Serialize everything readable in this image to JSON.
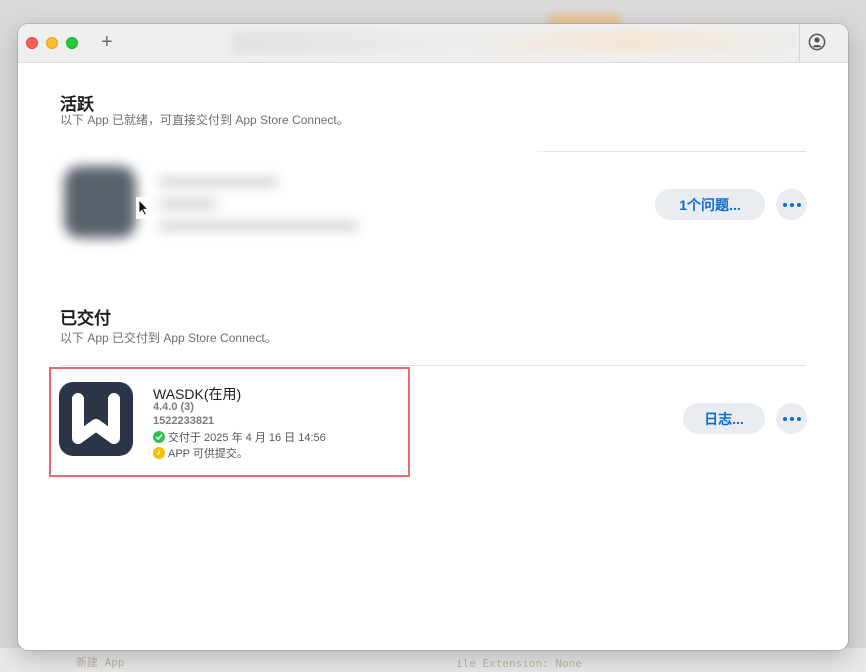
{
  "window": {
    "new_tab_symbol": "+",
    "controls": {
      "close_icon": "close-icon",
      "minimize_icon": "minimize-icon",
      "zoom_icon": "zoom-icon",
      "account_icon": "person-circle-icon"
    }
  },
  "background_code": {
    "left": "新建 App",
    "right": "ile Extension: None"
  },
  "sections": {
    "active": {
      "title": "活跃",
      "subtitle": "以下 App 已就绪，可直接交付到 App Store Connect。",
      "issue_button": "1个问题...",
      "more_icon": "ellipsis-icon"
    },
    "delivered": {
      "title": "已交付",
      "subtitle": "以下 App 已交付到 App Store Connect。",
      "app": {
        "name": "WASDK(在用)",
        "version": "4.4.0 (3)",
        "build_id": "1522233821",
        "delivered_status": "交付于 2025 年 4 月 16 日 14:56",
        "availability_status": "APP 可供提交。",
        "icon": "w-logo-icon"
      },
      "log_button": "日志...",
      "more_icon": "ellipsis-icon"
    }
  },
  "colors": {
    "accent": "#0a6bd6",
    "success": "#30c04f",
    "warning": "#f5c000",
    "highlight": "#ea6a6e",
    "app_icon_bg": "#2b3547"
  }
}
